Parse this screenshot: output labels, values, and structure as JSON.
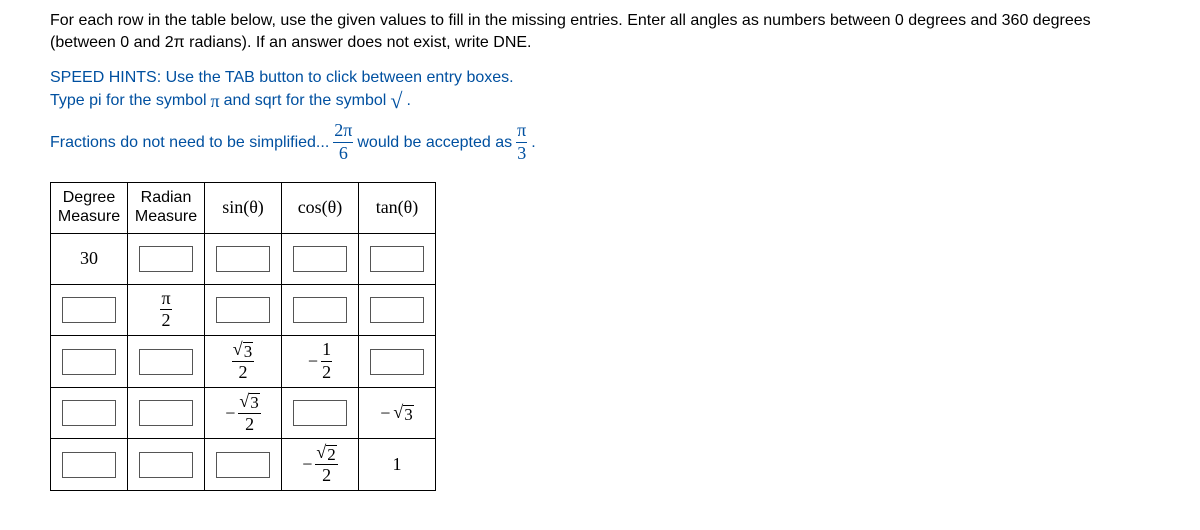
{
  "instructions": "For each row in the table below, use the given values to fill in the missing entries. Enter all angles as numbers between 0 degrees and 360 degrees (between 0 and 2π radians). If an answer does not exist, write DNE.",
  "hint_line1_a": "SPEED HINTS: Use the TAB button to click between entry boxes.",
  "hint_line2_a": "Type pi for the symbol ",
  "hint_line2_b": " and sqrt for the symbol ",
  "hint_line2_period": ".",
  "hint_pi": "π",
  "hint_surd": "√",
  "hint_line3_a": "Fractions do not need to be simplified...",
  "hint_line3_b": "would be accepted as",
  "hint_line3_period": ".",
  "frac_2pi_over_6": {
    "num": "2π",
    "den": "6"
  },
  "frac_pi_over_3": {
    "num": "π",
    "den": "3"
  },
  "headers": {
    "degree_a": "Degree",
    "degree_b": "Measure",
    "radian_a": "Radian",
    "radian_b": "Measure",
    "sin": "sin(θ)",
    "cos": "cos(θ)",
    "tan": "tan(θ)"
  },
  "rows": {
    "r1": {
      "degree": "30"
    },
    "r2": {
      "radian": {
        "num": "π",
        "den": "2"
      }
    },
    "r3": {
      "sin_num_root": "3",
      "sin_den": "2",
      "cos_sign": "−",
      "cos_num": "1",
      "cos_den": "2"
    },
    "r4": {
      "sin_sign": "−",
      "sin_num_root": "3",
      "sin_den": "2",
      "tan_sign": "−",
      "tan_root": "3"
    },
    "r5": {
      "cos_sign": "−",
      "cos_num_root": "2",
      "cos_den": "2",
      "tan": "1"
    }
  }
}
